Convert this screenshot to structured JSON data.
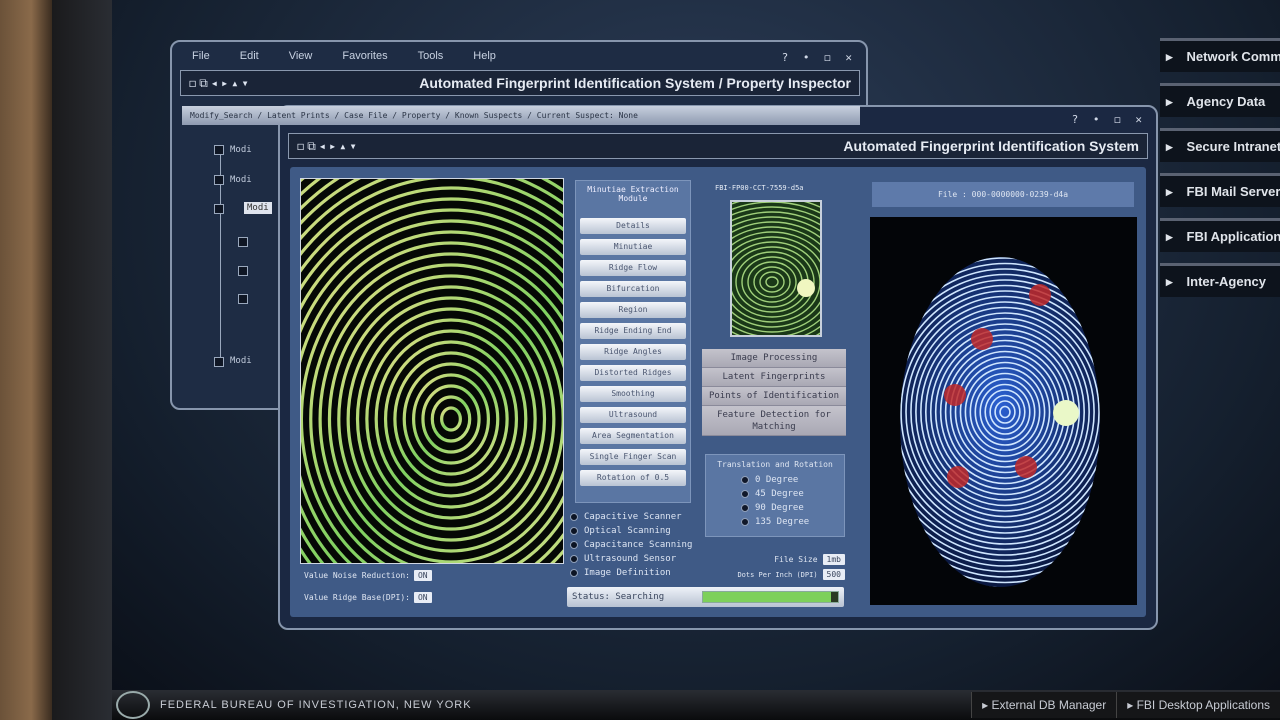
{
  "back_window": {
    "menu": [
      "File",
      "Edit",
      "View",
      "Favorites",
      "Tools",
      "Help"
    ],
    "window_controls": "? • ◻ ✕",
    "toolbar_icons": "◻⧉◂▸▴▾",
    "title": "Automated Fingerprint Identification System / Property Inspector",
    "path": "Modify_Search / Latent Prints / Case File / Property / Known Suspects / Current Suspect: None",
    "tree": [
      "Modi",
      "Modi",
      "Modi",
      "Modi"
    ]
  },
  "front_window": {
    "window_controls": "? • ◻ ✕",
    "toolbar_icons": "◻⧉◂▸▴▾",
    "title": "Automated Fingerprint Identification System",
    "extraction": {
      "header": "Minutiae Extraction Module",
      "buttons": [
        "Details",
        "Minutiae",
        "Ridge Flow",
        "Bifurcation",
        "Region",
        "Ridge Ending End",
        "Ridge Angles",
        "Distorted Ridges",
        "Smoothing",
        "Ultrasound",
        "Area Segmentation",
        "Single Finger Scan",
        "Rotation of 0.5"
      ]
    },
    "scan_options": [
      "Capacitive Scanner",
      "Optical Scanning",
      "Capacitance Scanning",
      "Ultrasound Sensor",
      "Image Definition"
    ],
    "fields": [
      {
        "label": "Value Noise Reduction:",
        "value": "ON"
      },
      {
        "label": "Value Ridge Base(DPI):",
        "value": "ON"
      }
    ],
    "sample_id": "FBI-FP00-CCT-7559-d5a",
    "actions": [
      "Image Processing",
      "Latent Fingerprints",
      "Points of Identification",
      "Feature Detection for Matching"
    ],
    "rotation": {
      "header": "Translation and Rotation",
      "options": [
        "0 Degree",
        "45 Degree",
        "90 Degree",
        "135 Degree"
      ]
    },
    "file_size": {
      "label": "File Size",
      "value": "1mb"
    },
    "dots": {
      "label": "Dots Per Inch (DPI)",
      "value": "500"
    },
    "status": {
      "label": "Status: Searching",
      "progress": 0.95,
      "color": "#7dd05a"
    },
    "file_label": "File : 000-0000000-0239-d4a"
  },
  "sidebar": [
    "Network Communications",
    "Agency Data",
    "Secure Intranet",
    "FBI Mail Server",
    "FBI Applications",
    "Inter-Agency"
  ],
  "bottom": {
    "org": "FEDERAL BUREAU OF INVESTIGATION, NEW YORK",
    "tabs": [
      "External DB Manager",
      "FBI Desktop Applications"
    ]
  }
}
